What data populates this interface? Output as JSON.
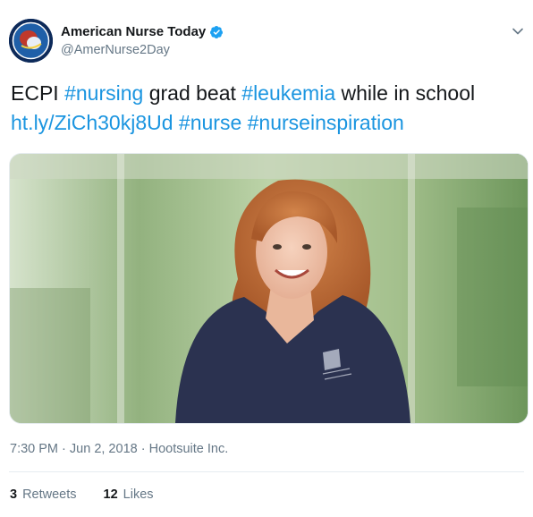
{
  "author": {
    "display_name": "American Nurse Today",
    "handle": "@AmerNurse2Day",
    "verified": true
  },
  "tweet": {
    "text_parts": [
      "ECPI ",
      "#nursing",
      " grad beat ",
      "#leukemia",
      " while in school"
    ],
    "link": "ht.ly/ZiCh30kj8Ud",
    "hashtags_line2": [
      "#nurse",
      "#nurseinspiration"
    ]
  },
  "meta": {
    "time": "7:30 PM",
    "date": "Jun 2, 2018",
    "source": "Hootsuite Inc.",
    "separator": "·"
  },
  "stats": {
    "retweets_count": "3",
    "retweets_label": "Retweets",
    "likes_count": "12",
    "likes_label": "Likes"
  },
  "icons": {
    "verified": "verified-badge-icon",
    "menu": "chevron-down-icon"
  },
  "colors": {
    "link": "#1b95e0",
    "secondary": "#657786",
    "primary_text": "#14171a"
  }
}
